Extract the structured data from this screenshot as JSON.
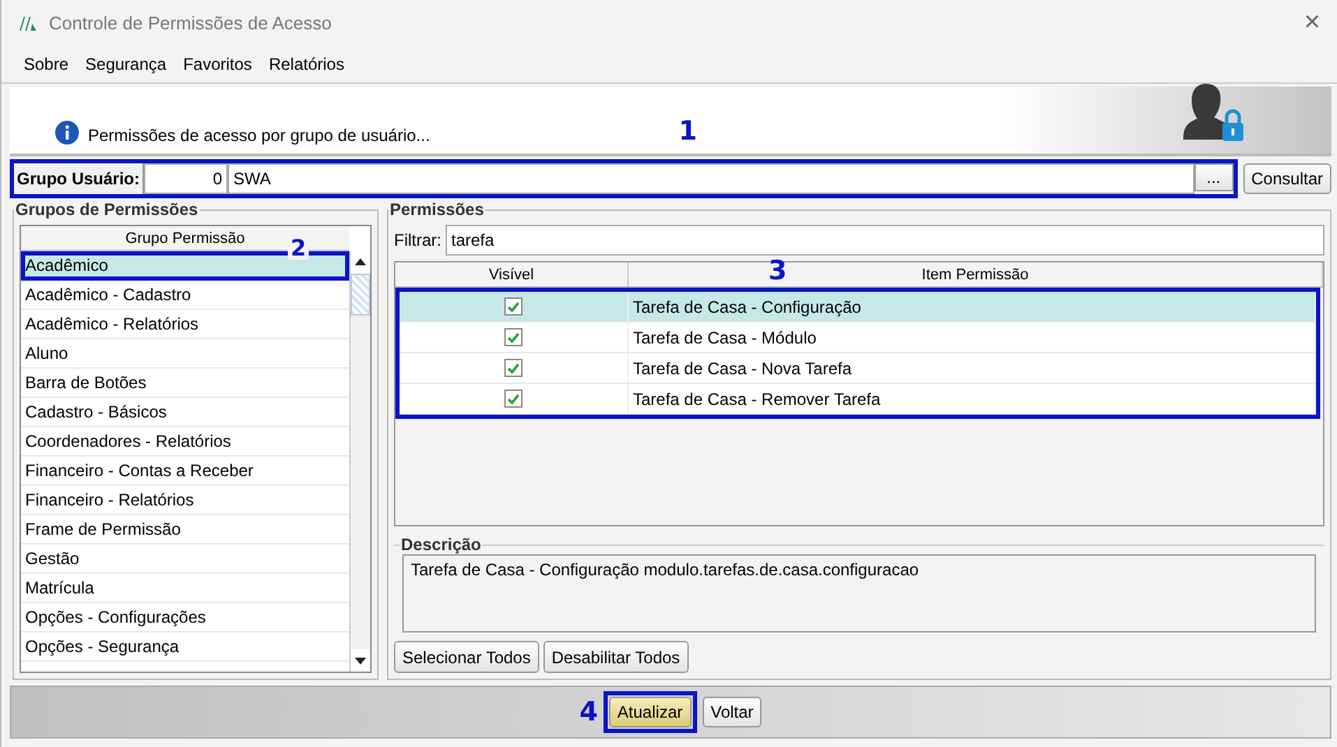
{
  "window": {
    "title": "Controle de Permissões de Acesso",
    "close": "×"
  },
  "menu": [
    {
      "label": "Sobre"
    },
    {
      "label": "Segurança"
    },
    {
      "label": "Favoritos"
    },
    {
      "label": "Relatórios"
    }
  ],
  "banner": {
    "message": "Permissões de acesso por grupo de usuário..."
  },
  "user_group": {
    "label": "Grupo Usuário:",
    "code": "0",
    "name": "SWA",
    "browse": "...",
    "query_button": "Consultar",
    "callout": "1"
  },
  "groups_panel": {
    "title": "Grupos de Permissões",
    "column": "Grupo Permissão",
    "callout": "2",
    "items": [
      {
        "label": "Acadêmico",
        "selected": true
      },
      {
        "label": "Acadêmico - Cadastro",
        "selected": false
      },
      {
        "label": "Acadêmico - Relatórios",
        "selected": false
      },
      {
        "label": "Aluno",
        "selected": false
      },
      {
        "label": "Barra de Botões",
        "selected": false
      },
      {
        "label": "Cadastro - Básicos",
        "selected": false
      },
      {
        "label": "Coordenadores - Relatórios",
        "selected": false
      },
      {
        "label": "Financeiro - Contas a Receber",
        "selected": false
      },
      {
        "label": "Financeiro - Relatórios",
        "selected": false
      },
      {
        "label": "Frame de Permissão",
        "selected": false
      },
      {
        "label": "Gestão",
        "selected": false
      },
      {
        "label": "Matrícula",
        "selected": false
      },
      {
        "label": "Opções - Configurações",
        "selected": false
      },
      {
        "label": "Opções - Segurança",
        "selected": false
      }
    ]
  },
  "permissions_panel": {
    "title": "Permissões",
    "filter_label": "Filtrar:",
    "filter_value": "tarefa",
    "columns": [
      "Visível",
      "Item Permissão"
    ],
    "callout": "3",
    "rows": [
      {
        "visible": true,
        "item": "Tarefa de Casa - Configuração",
        "selected": true
      },
      {
        "visible": true,
        "item": "Tarefa de Casa - Módulo",
        "selected": false
      },
      {
        "visible": true,
        "item": "Tarefa de Casa - Nova Tarefa",
        "selected": false
      },
      {
        "visible": true,
        "item": "Tarefa de Casa - Remover Tarefa",
        "selected": false
      }
    ],
    "description_title": "Descrição",
    "description": "Tarefa de Casa - Configuração modulo.tarefas.de.casa.configuracao",
    "buttons": [
      "Selecionar Todos",
      "Desabilitar Todos"
    ]
  },
  "footer": {
    "callout": "4",
    "buttons": [
      {
        "label": "Atualizar",
        "kind": "primary"
      },
      {
        "label": "Voltar",
        "kind": "normal"
      }
    ]
  }
}
